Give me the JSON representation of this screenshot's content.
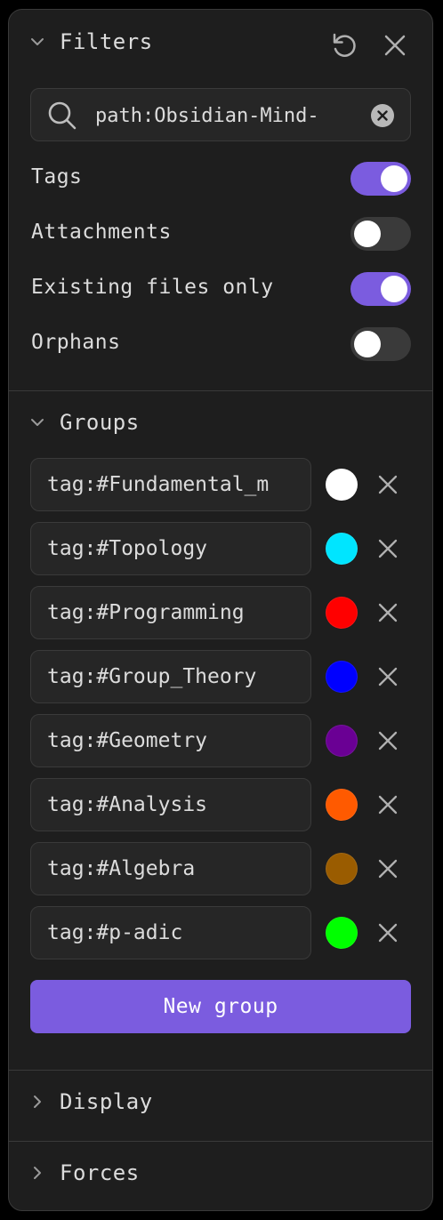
{
  "filters": {
    "title": "Filters",
    "search": {
      "value": "path:Obsidian-Mind-",
      "placeholder": ""
    },
    "toggles": [
      {
        "label": "Tags",
        "on": true
      },
      {
        "label": "Attachments",
        "on": false
      },
      {
        "label": "Existing files only",
        "on": true
      },
      {
        "label": "Orphans",
        "on": false
      }
    ]
  },
  "groups": {
    "title": "Groups",
    "items": [
      {
        "query": "tag:#Fundamental_m",
        "color": "#ffffff"
      },
      {
        "query": "tag:#Topology",
        "color": "#00e5ff"
      },
      {
        "query": "tag:#Programming",
        "color": "#ff0000"
      },
      {
        "query": "tag:#Group_Theory",
        "color": "#0000ff"
      },
      {
        "query": "tag:#Geometry",
        "color": "#6a0094"
      },
      {
        "query": "tag:#Analysis",
        "color": "#ff5a00"
      },
      {
        "query": "tag:#Algebra",
        "color": "#9a5c00"
      },
      {
        "query": "tag:#p-adic",
        "color": "#00ff00"
      }
    ],
    "new_group_label": "New group"
  },
  "display": {
    "title": "Display"
  },
  "forces": {
    "title": "Forces"
  },
  "colors": {
    "accent": "#7b5cdf",
    "panel": "#1e1e1e",
    "switch_off": "#3a3a3a"
  },
  "icons": {
    "collapse": "chevron-down-icon",
    "expand": "chevron-right-icon",
    "reset": "restore-icon",
    "close": "close-icon",
    "search": "search-icon",
    "clear": "clear-circle-icon",
    "remove": "close-icon"
  }
}
